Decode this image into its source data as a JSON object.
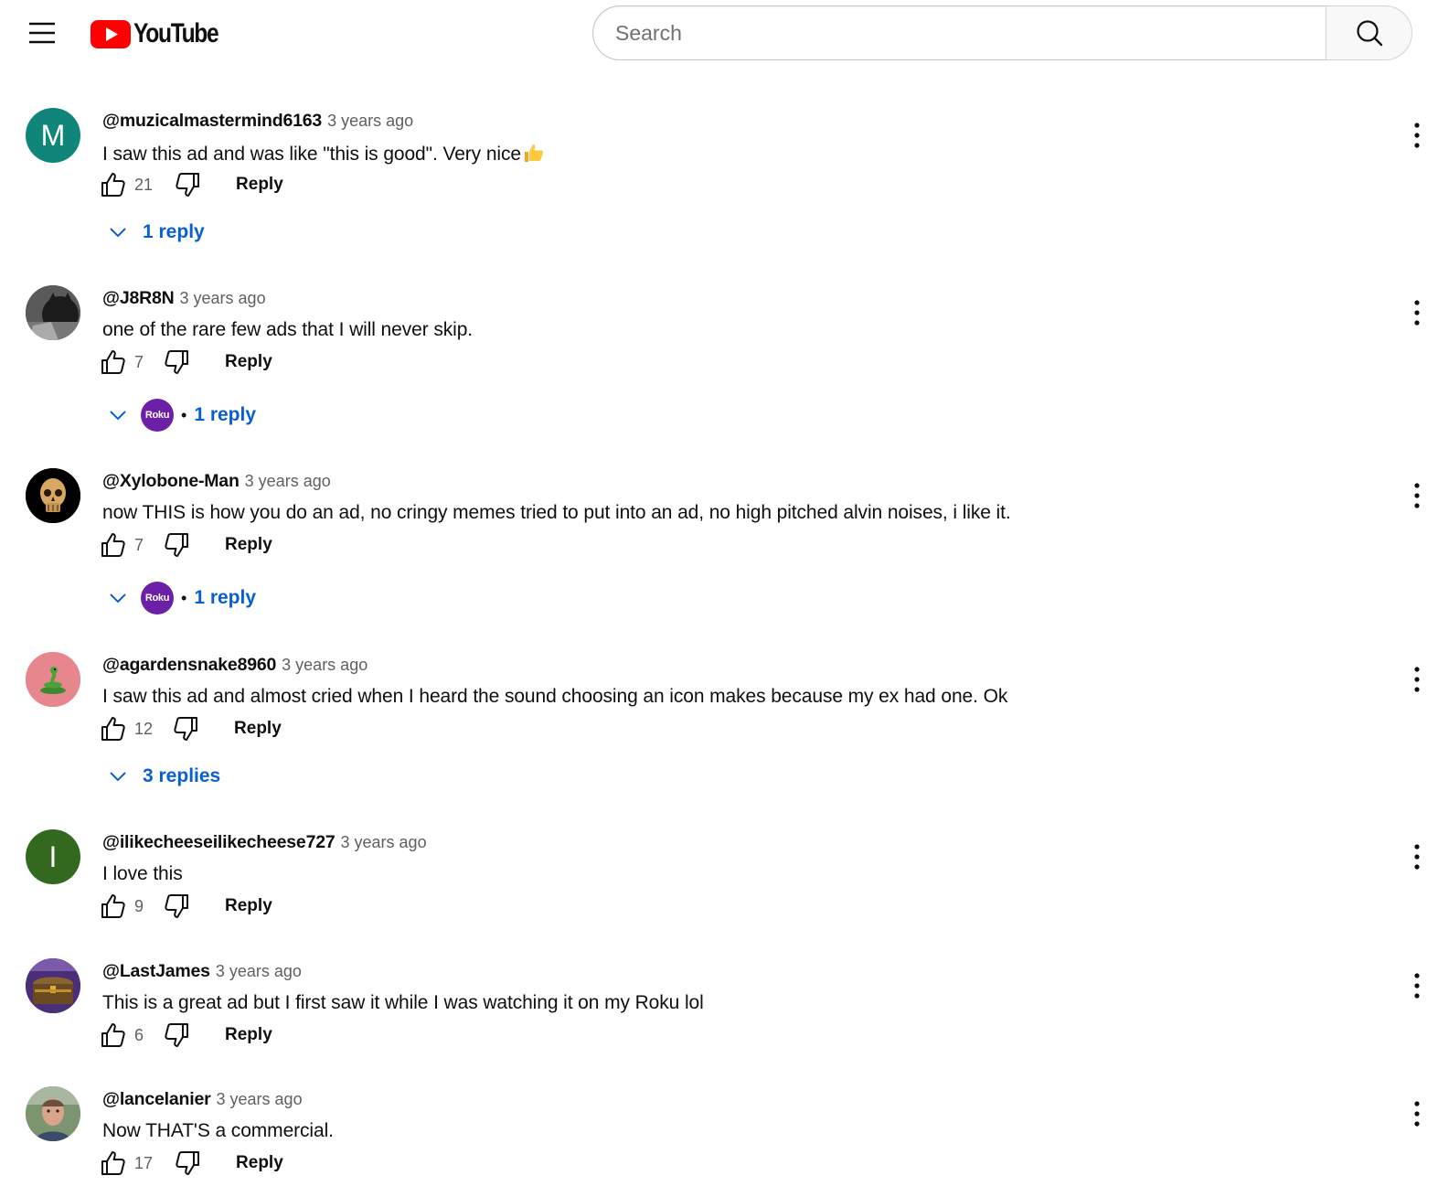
{
  "header": {
    "logo_text": "YouTube",
    "search_placeholder": "Search"
  },
  "comments": [
    {
      "author": "@muzicalmastermind6163",
      "time": "3 years ago",
      "text": "I saw this ad and was like \"this is good\". Very nice",
      "likes": "21",
      "reply_label": "Reply",
      "replies_label": "1 reply",
      "avatar_letter": "M",
      "avatar_color": "#10857a"
    },
    {
      "author": "@J8R8N",
      "time": "3 years ago",
      "text": "one of the rare few ads that I will never skip.",
      "likes": "7",
      "reply_label": "Reply",
      "replies_label": "1 reply",
      "replier_avatar_text": "Roku",
      "separator": "•"
    },
    {
      "author": "@Xylobone-Man",
      "time": "3 years ago",
      "text": "now THIS is how you do an ad, no cringy memes tried to put into an ad, no high pitched alvin noises, i like it.",
      "likes": "7",
      "reply_label": "Reply",
      "replies_label": "1 reply",
      "replier_avatar_text": "Roku",
      "separator": "•"
    },
    {
      "author": "@agardensnake8960",
      "time": "3 years ago",
      "text": "I saw this ad and almost cried when I heard the sound choosing an icon makes because my ex had one. Ok",
      "likes": "12",
      "reply_label": "Reply",
      "replies_label": "3 replies",
      "avatar_color": "#e8868e"
    },
    {
      "author": "@ilikecheeseilikecheese727",
      "time": "3 years ago",
      "text": "I love this",
      "likes": "9",
      "reply_label": "Reply",
      "avatar_letter": "I",
      "avatar_color": "#33691e"
    },
    {
      "author": "@LastJames",
      "time": "3 years ago",
      "text": "This is a great ad but I first saw it while I was watching it on my Roku lol",
      "likes": "6",
      "reply_label": "Reply"
    },
    {
      "author": "@lancelanier",
      "time": "3 years ago",
      "text": "Now THAT'S a commercial.",
      "likes": "17",
      "reply_label": "Reply"
    }
  ],
  "colors": {
    "brand_red": "#ff0000",
    "link_blue": "#065fd4",
    "roku_purple": "#6c1fa7",
    "secondary_text": "#606060"
  }
}
